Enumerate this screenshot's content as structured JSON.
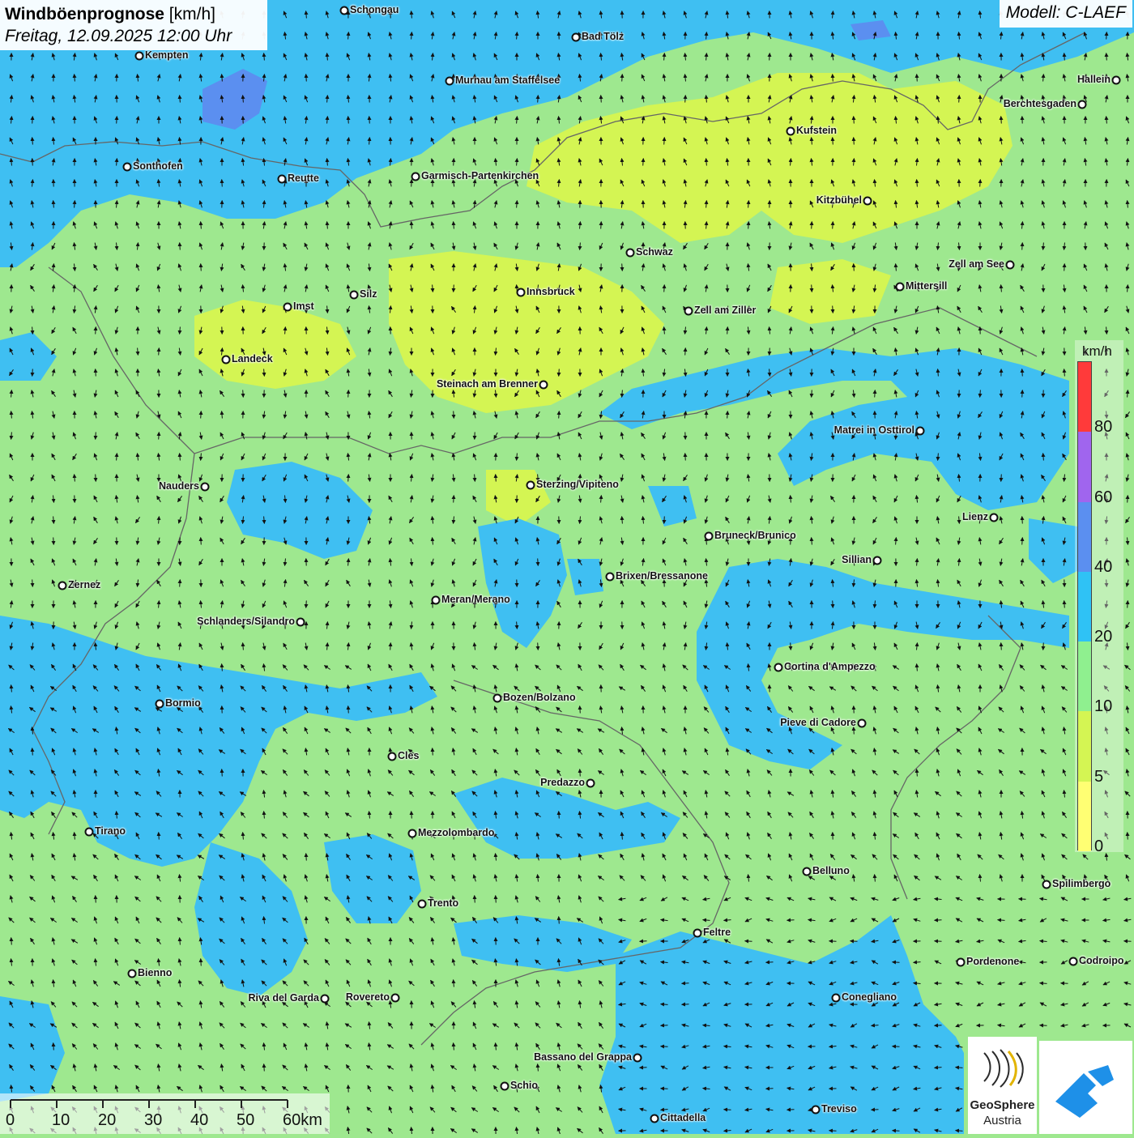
{
  "title": {
    "bold": "Windböenprognose",
    "unit": " [km/h]",
    "date": "Freitag, 12.09.2025 12:00 Uhr"
  },
  "model": "Modell: C-LAEF",
  "legend": {
    "unit": "km/h",
    "ticks": [
      "80",
      "60",
      "40",
      "20",
      "10",
      "5",
      "0"
    ],
    "colors": [
      "#ff3a3a",
      "#a065ee",
      "#5b8ff0",
      "#2fc2f5",
      "#8ff08f",
      "#d4f553",
      "#ffff73"
    ]
  },
  "scalebar": {
    "labels": [
      "0",
      "10",
      "20",
      "30",
      "40",
      "50",
      "60km"
    ]
  },
  "logo": {
    "name": "GeoSphere",
    "sub": "Austria"
  },
  "colors": {
    "calm": "#ffff73",
    "light": "#d4f553",
    "moderate": "#9ee88f",
    "fresh": "#3fbff2",
    "strong": "#5b8ff0"
  },
  "cities": [
    {
      "name": "Schongau",
      "label": "right"
    },
    {
      "name": "Kempten",
      "label": "right"
    },
    {
      "name": "Bad Tölz",
      "label": "right"
    },
    {
      "name": "Murnau am Staffelsee",
      "label": "right"
    },
    {
      "name": "Hallein",
      "label": "left"
    },
    {
      "name": "Berchtesgaden",
      "label": "left"
    },
    {
      "name": "Kufstein",
      "label": "right"
    },
    {
      "name": "Sonthofen",
      "label": "right"
    },
    {
      "name": "Reutte",
      "label": "right"
    },
    {
      "name": "Garmisch-Partenkirchen",
      "label": "right"
    },
    {
      "name": "Kitzbühel",
      "label": "left"
    },
    {
      "name": "Schwaz",
      "label": "right"
    },
    {
      "name": "Zell am See",
      "label": "left"
    },
    {
      "name": "Mittersill",
      "label": "right"
    },
    {
      "name": "Innsbruck",
      "label": "right"
    },
    {
      "name": "Silz",
      "label": "right"
    },
    {
      "name": "Imst",
      "label": "right"
    },
    {
      "name": "Zell am Ziller",
      "label": "right"
    },
    {
      "name": "Landeck",
      "label": "right"
    },
    {
      "name": "Steinach am Brenner",
      "label": "left"
    },
    {
      "name": "Matrei in Osttirol",
      "label": "left"
    },
    {
      "name": "Nauders",
      "label": "left"
    },
    {
      "name": "Sterzing/Vipiteno",
      "label": "right"
    },
    {
      "name": "Lienz",
      "label": "left"
    },
    {
      "name": "Bruneck/Brunico",
      "label": "right"
    },
    {
      "name": "Sillian",
      "label": "left"
    },
    {
      "name": "Brixen/Bressanone",
      "label": "right"
    },
    {
      "name": "Zernez",
      "label": "right"
    },
    {
      "name": "Meran/Merano",
      "label": "right"
    },
    {
      "name": "Schlanders/Silandro",
      "label": "left"
    },
    {
      "name": "Cortina d'Ampezzo",
      "label": "right"
    },
    {
      "name": "Bormio",
      "label": "right"
    },
    {
      "name": "Bozen/Bolzano",
      "label": "right"
    },
    {
      "name": "Pieve di Cadore",
      "label": "left"
    },
    {
      "name": "Cles",
      "label": "right"
    },
    {
      "name": "Predazzo",
      "label": "left"
    },
    {
      "name": "Tirano",
      "label": "right"
    },
    {
      "name": "Mezzolombardo",
      "label": "right"
    },
    {
      "name": "Belluno",
      "label": "right"
    },
    {
      "name": "Spilimbergo",
      "label": "right"
    },
    {
      "name": "Trento",
      "label": "right"
    },
    {
      "name": "Feltre",
      "label": "right"
    },
    {
      "name": "Pordenone",
      "label": "right"
    },
    {
      "name": "Codroipo",
      "label": "right"
    },
    {
      "name": "Bienno",
      "label": "right"
    },
    {
      "name": "Riva del Garda",
      "label": "left"
    },
    {
      "name": "Rovereto",
      "label": "left"
    },
    {
      "name": "Conegliano",
      "label": "right"
    },
    {
      "name": "Bassano del Grappa",
      "label": "left"
    },
    {
      "name": "Schio",
      "label": "right"
    },
    {
      "name": "Treviso",
      "label": "right"
    },
    {
      "name": "Cittadella",
      "label": "right"
    }
  ]
}
